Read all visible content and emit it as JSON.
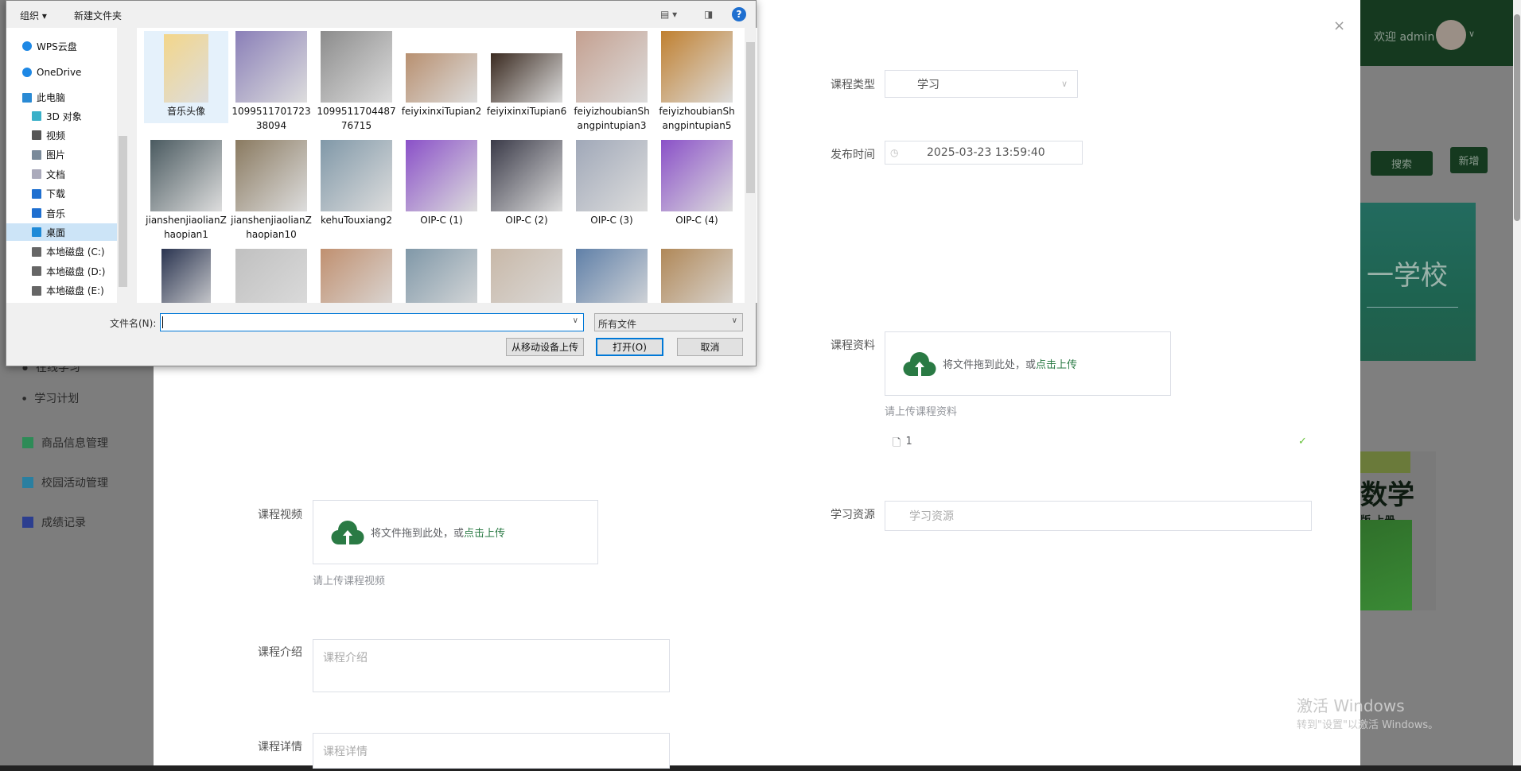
{
  "sidebar": {
    "items": [
      {
        "label": "在线学习",
        "icon": "dot-icon"
      },
      {
        "label": "学习计划",
        "icon": "dot-icon"
      },
      {
        "label": "商品信息管理",
        "icon": "grid-icon",
        "color": "#2e8b57"
      },
      {
        "label": "校园活动管理",
        "icon": "grid-icon",
        "color": "#2a7fa0"
      },
      {
        "label": "成绩记录",
        "icon": "record-icon",
        "color": "#2c3e8f"
      }
    ]
  },
  "header": {
    "welcome": "欢迎 admin"
  },
  "background": {
    "search_label": "搜索",
    "add_label": "新增",
    "banner_text": "一学校",
    "book_title": "数学",
    "book_sub": "版 上册"
  },
  "form": {
    "course_type": {
      "label": "课程类型",
      "value": "学习"
    },
    "publish_time": {
      "label": "发布时间",
      "value": "2025-03-23 13:59:40"
    },
    "material": {
      "label": "课程资料",
      "drop_text": "将文件拖到此处，或",
      "click_text": "点击上传",
      "hint": "请上传课程资料",
      "file_name": "1"
    },
    "resource": {
      "label": "学习资源",
      "placeholder": "学习资源"
    },
    "video": {
      "label": "课程视频",
      "drop_text": "将文件拖到此处，或",
      "click_text": "点击上传",
      "hint": "请上传课程视频"
    },
    "intro": {
      "label": "课程介绍",
      "placeholder": "课程介绍"
    },
    "detail": {
      "label": "课程详情",
      "placeholder": "课程详情"
    }
  },
  "watermark": {
    "line1": "激活 Windows",
    "line2": "转到\"设置\"以激活 Windows。"
  },
  "dialog": {
    "toolbar": {
      "organize": "组织 ▾",
      "new_folder": "新建文件夹"
    },
    "nav": [
      {
        "label": "WPS云盘",
        "icon": "cloud-icon"
      },
      {
        "label": "OneDrive",
        "icon": "cloud-icon"
      },
      {
        "label": "此电脑",
        "icon": "computer-icon"
      },
      {
        "label": "3D 对象",
        "icon": "cube-icon"
      },
      {
        "label": "视频",
        "icon": "video-icon"
      },
      {
        "label": "图片",
        "icon": "picture-icon"
      },
      {
        "label": "文档",
        "icon": "document-icon"
      },
      {
        "label": "下载",
        "icon": "download-icon"
      },
      {
        "label": "音乐",
        "icon": "music-icon"
      },
      {
        "label": "桌面",
        "icon": "desktop-icon",
        "selected": true
      },
      {
        "label": "本地磁盘 (C:)",
        "icon": "drive-icon"
      },
      {
        "label": "本地磁盘 (D:)",
        "icon": "drive-icon"
      },
      {
        "label": "本地磁盘 (E:)",
        "icon": "drive-icon"
      }
    ],
    "files": [
      {
        "name": "音乐头像",
        "type": "folder"
      },
      {
        "name": "109951170172338094"
      },
      {
        "name": "109951170448776715"
      },
      {
        "name": "feiyixinxiTupian2"
      },
      {
        "name": "feiyixinxiTupian6"
      },
      {
        "name": "feiyizhoubianShangpintupian3"
      },
      {
        "name": "feiyizhoubianShangpintupian5"
      },
      {
        "name": "jianshenjiaolianZhaopian1"
      },
      {
        "name": "jianshenjiaolianZhaopian10"
      },
      {
        "name": "kehuTouxiang2"
      },
      {
        "name": "OIP-C (1)"
      },
      {
        "name": "OIP-C (2)"
      },
      {
        "name": "OIP-C (3)"
      },
      {
        "name": "OIP-C (4)"
      },
      {
        "name": ""
      },
      {
        "name": ""
      },
      {
        "name": ""
      },
      {
        "name": ""
      },
      {
        "name": ""
      },
      {
        "name": ""
      },
      {
        "name": ""
      }
    ],
    "filename_label": "文件名(N):",
    "filename_value": "",
    "filter": "所有文件",
    "mobile_upload": "从移动设备上传",
    "open": "打开(O)",
    "cancel": "取消"
  }
}
